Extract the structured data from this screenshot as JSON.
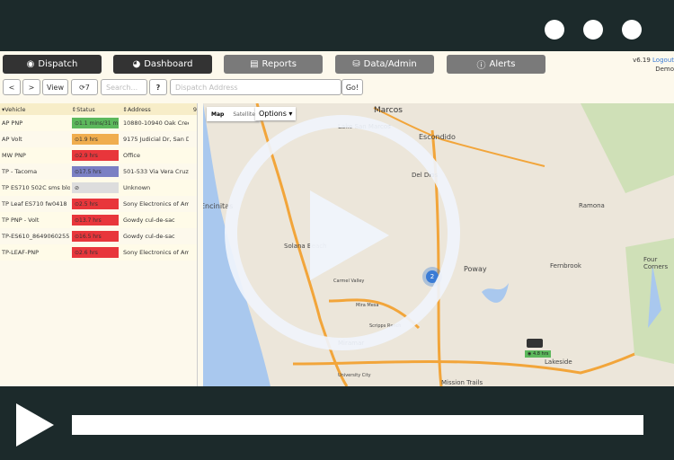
{
  "nav": {
    "dispatch": "Dispatch",
    "dashboard": "Dashboard",
    "reports": "Reports",
    "data_admin": "Data/Admin",
    "alerts": "Alerts"
  },
  "header": {
    "version": "v6.19",
    "logout": "Logout",
    "user": "Demo"
  },
  "toolbar": {
    "prev": "<",
    "next": ">",
    "view": "View",
    "refresh_count": "7",
    "search_placeholder": "Search...",
    "help": "?",
    "address_placeholder": "Dispatch Address",
    "go": "Go!"
  },
  "grid": {
    "headers": [
      "Vehicle",
      "Status",
      "Address"
    ],
    "count": "9",
    "rows": [
      {
        "vehicle": "AP PNP",
        "status": "1.1 mins/31 m",
        "color": "#5cb85c",
        "address": "10880-10940 Oak Cree..."
      },
      {
        "vehicle": "AP Volt",
        "status": "1.9 hrs",
        "color": "#f0ad4e",
        "address": "9175 Judicial Dr, San Di..."
      },
      {
        "vehicle": "MW PNP",
        "status": "2.9 hrs",
        "color": "#e8363b",
        "address": "Office"
      },
      {
        "vehicle": "TP - Tacoma",
        "status": "17.5 hrs",
        "color": "#7a7fc4",
        "address": "501-533 Via Vera Cruz, ..."
      },
      {
        "vehicle": "TP ES710 502C sms blo...",
        "status": "",
        "color": "#ddd",
        "address": "Unknown"
      },
      {
        "vehicle": "TP Leaf ES710 fw0418",
        "status": "2.5 hrs",
        "color": "#e8363b",
        "address": "Sony Electronics of Am..."
      },
      {
        "vehicle": "TP PNP - Volt",
        "status": "13.7 hrs",
        "color": "#e8363b",
        "address": "Gowdy cul-de-sac"
      },
      {
        "vehicle": "TP-ES610_8649060255...",
        "status": "16.5 hrs",
        "color": "#e8363b",
        "address": "Gowdy cul-de-sac"
      },
      {
        "vehicle": "TP-LEAF-PNP",
        "status": "2.6 hrs",
        "color": "#e8363b",
        "address": "Sony Electronics of Am..."
      }
    ]
  },
  "map": {
    "type_map": "Map",
    "type_satellite": "Satellite",
    "options": "Options",
    "places": [
      "Marcos",
      "Lake San Marcos",
      "Escondido",
      "Del Dios",
      "Encinitas",
      "Solana Beach",
      "Ramona",
      "Poway",
      "Fernbrook",
      "Four Corners",
      "Lakeside",
      "Carmel Valley",
      "Mira Mesa",
      "Scripps Ranch",
      "Miramar",
      "University City",
      "Mission Trails"
    ],
    "cluster": "2",
    "vehicle_badge": "4.8 hrs"
  }
}
